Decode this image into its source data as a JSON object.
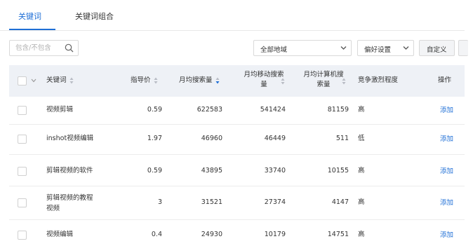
{
  "tabs": [
    {
      "label": "关键词",
      "active": true
    },
    {
      "label": "关键词组合",
      "active": false
    }
  ],
  "toolbar": {
    "search_placeholder": "包含/不包含",
    "region_select": "全部地域",
    "preference_select": "偏好设置",
    "custom_button": "自定义"
  },
  "table": {
    "headers": {
      "keyword": "关键词",
      "price": "指导价",
      "monthly": "月均搜索量",
      "mobile_line1": "月均移动搜索",
      "mobile_line2": "量",
      "pc_line1": "月均计算机搜",
      "pc_line2": "索量",
      "competition": "竞争激烈程度",
      "action": "操作"
    },
    "rows": [
      {
        "keyword": "视频剪辑",
        "keyword2": "",
        "price": "0.59",
        "monthly": "622583",
        "mobile": "541424",
        "pc": "81159",
        "competition": "高",
        "action": "添加"
      },
      {
        "keyword": "inshot视频编辑",
        "keyword2": "",
        "price": "1.97",
        "monthly": "46960",
        "mobile": "46449",
        "pc": "511",
        "competition": "低",
        "action": "添加"
      },
      {
        "keyword": "剪辑视频的软件",
        "keyword2": "",
        "price": "0.59",
        "monthly": "43895",
        "mobile": "33740",
        "pc": "10155",
        "competition": "高",
        "action": "添加"
      },
      {
        "keyword": "剪辑视频的教程",
        "keyword2": "视频",
        "price": "3",
        "monthly": "31521",
        "mobile": "27374",
        "pc": "4147",
        "competition": "高",
        "action": "添加"
      },
      {
        "keyword": "视频编辑",
        "keyword2": "",
        "price": "0.4",
        "monthly": "24930",
        "mobile": "10179",
        "pc": "14751",
        "competition": "高",
        "action": "添加"
      }
    ]
  },
  "colors": {
    "accent": "#1f6fd6",
    "header_bg": "#eef1f6"
  }
}
